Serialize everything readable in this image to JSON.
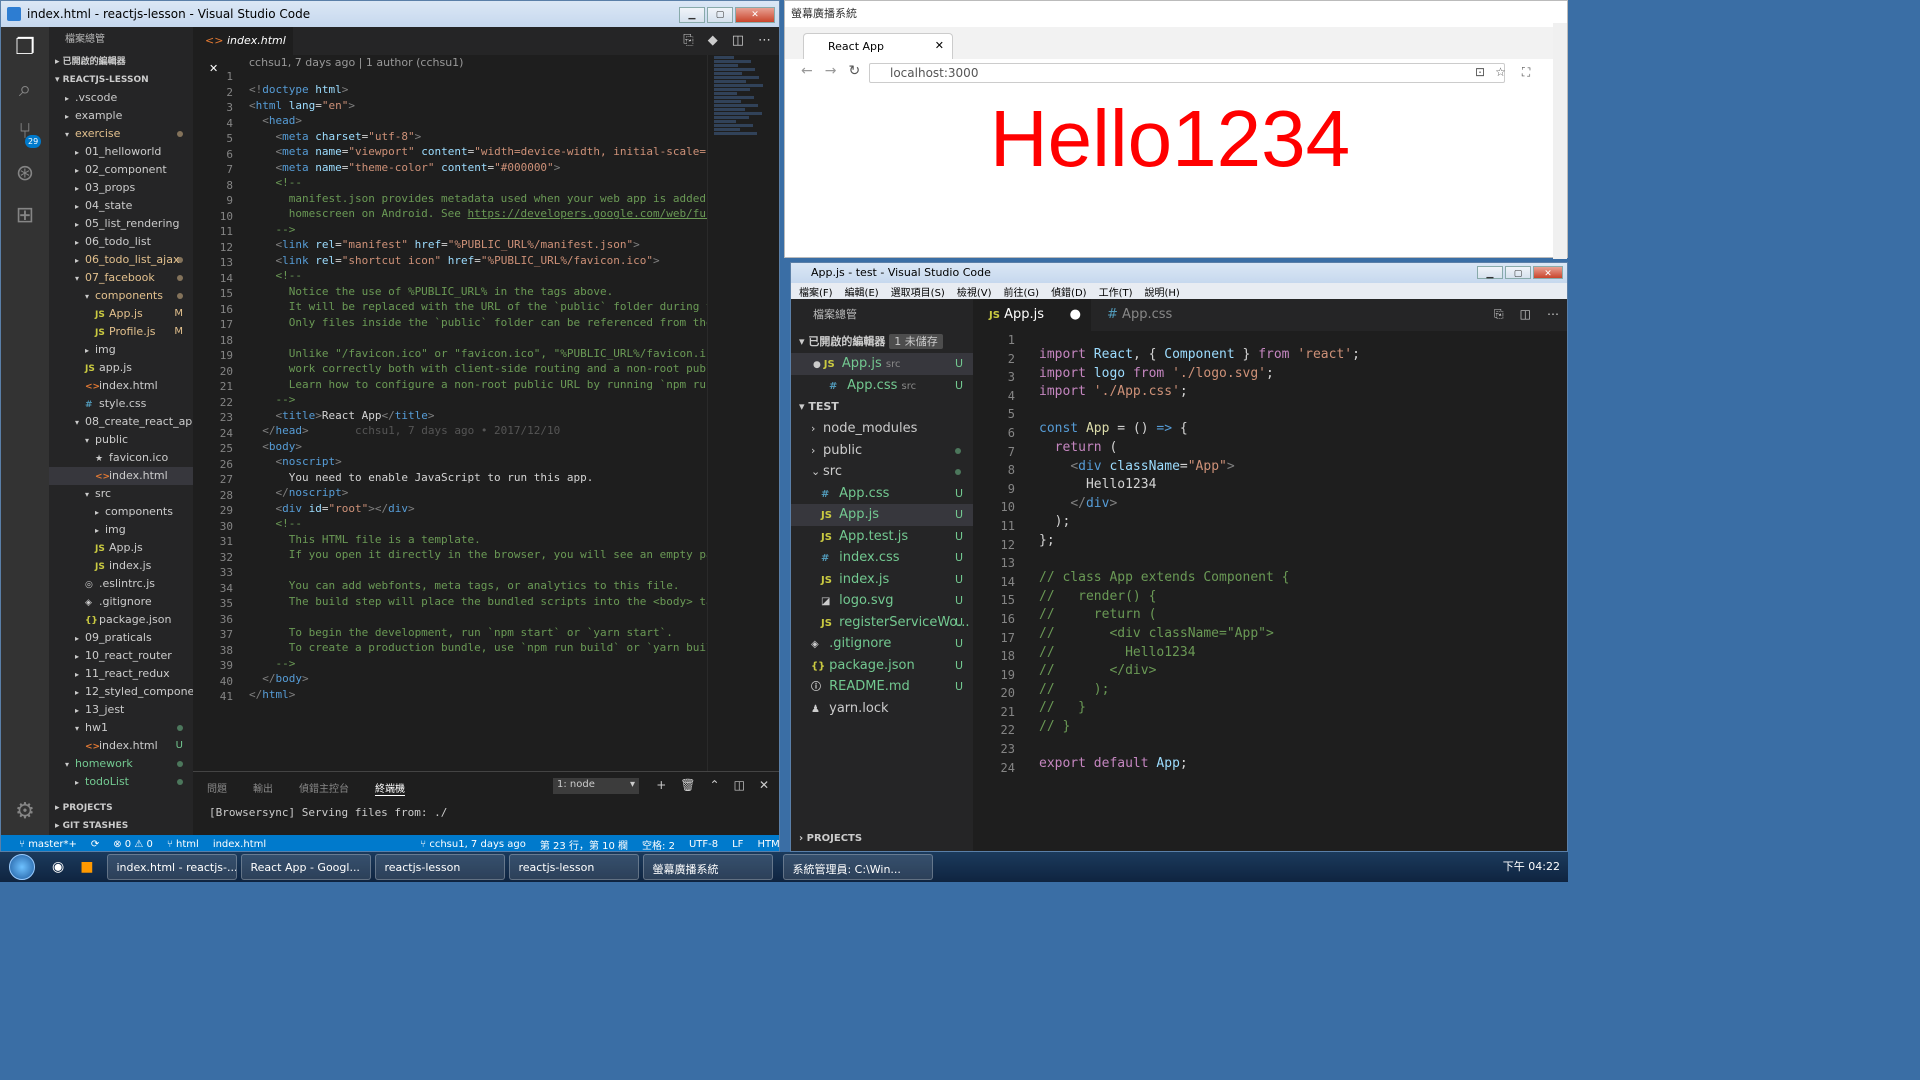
{
  "left_window": {
    "title": "index.html - reactjs-lesson - Visual Studio Code",
    "explorer_header": "檔案總管",
    "open_editors": "已開啟的編輯器",
    "root": "REACTJS-LESSON",
    "tree": [
      {
        "label": ".vscode",
        "indent": 1,
        "arrow": "▸",
        "icon": "",
        "mark": ""
      },
      {
        "label": "example",
        "indent": 1,
        "arrow": "▸",
        "icon": "",
        "mark": ""
      },
      {
        "label": "exercise",
        "indent": 1,
        "arrow": "▾",
        "icon": "",
        "mark": "dot",
        "color": "m"
      },
      {
        "label": "01_helloworld",
        "indent": 2,
        "arrow": "▸",
        "icon": "",
        "mark": ""
      },
      {
        "label": "02_component",
        "indent": 2,
        "arrow": "▸",
        "icon": "",
        "mark": ""
      },
      {
        "label": "03_props",
        "indent": 2,
        "arrow": "▸",
        "icon": "",
        "mark": ""
      },
      {
        "label": "04_state",
        "indent": 2,
        "arrow": "▸",
        "icon": "",
        "mark": ""
      },
      {
        "label": "05_list_rendering",
        "indent": 2,
        "arrow": "▸",
        "icon": "",
        "mark": ""
      },
      {
        "label": "06_todo_list",
        "indent": 2,
        "arrow": "▸",
        "icon": "",
        "mark": ""
      },
      {
        "label": "06_todo_list_ajax",
        "indent": 2,
        "arrow": "▸",
        "icon": "",
        "mark": "dot",
        "color": "m"
      },
      {
        "label": "07_facebook",
        "indent": 2,
        "arrow": "▾",
        "icon": "",
        "mark": "dot",
        "color": "m"
      },
      {
        "label": "components",
        "indent": 3,
        "arrow": "▾",
        "icon": "",
        "mark": "dot",
        "color": "m"
      },
      {
        "label": "App.js",
        "indent": 4,
        "arrow": "",
        "icon": "JS",
        "mark": "M",
        "color": "m"
      },
      {
        "label": "Profile.js",
        "indent": 4,
        "arrow": "",
        "icon": "JS",
        "mark": "M",
        "color": "m"
      },
      {
        "label": "img",
        "indent": 3,
        "arrow": "▸",
        "icon": "",
        "mark": ""
      },
      {
        "label": "app.js",
        "indent": 3,
        "arrow": "",
        "icon": "JS",
        "mark": ""
      },
      {
        "label": "index.html",
        "indent": 3,
        "arrow": "",
        "icon": "<>",
        "mark": ""
      },
      {
        "label": "style.css",
        "indent": 3,
        "arrow": "",
        "icon": "#",
        "mark": ""
      },
      {
        "label": "08_create_react_app",
        "indent": 2,
        "arrow": "▾",
        "icon": "",
        "mark": ""
      },
      {
        "label": "public",
        "indent": 3,
        "arrow": "▾",
        "icon": "",
        "mark": ""
      },
      {
        "label": "favicon.ico",
        "indent": 4,
        "arrow": "",
        "icon": "★",
        "mark": ""
      },
      {
        "label": "index.html",
        "indent": 4,
        "arrow": "",
        "icon": "<>",
        "mark": "",
        "selected": true
      },
      {
        "label": "src",
        "indent": 3,
        "arrow": "▾",
        "icon": "",
        "mark": ""
      },
      {
        "label": "components",
        "indent": 4,
        "arrow": "▸",
        "icon": "",
        "mark": ""
      },
      {
        "label": "img",
        "indent": 4,
        "arrow": "▸",
        "icon": "",
        "mark": ""
      },
      {
        "label": "App.js",
        "indent": 4,
        "arrow": "",
        "icon": "JS",
        "mark": ""
      },
      {
        "label": "index.js",
        "indent": 4,
        "arrow": "",
        "icon": "JS",
        "mark": ""
      },
      {
        "label": ".eslintrc.js",
        "indent": 3,
        "arrow": "",
        "icon": "◎",
        "mark": ""
      },
      {
        "label": ".gitignore",
        "indent": 3,
        "arrow": "",
        "icon": "◈",
        "mark": ""
      },
      {
        "label": "package.json",
        "indent": 3,
        "arrow": "",
        "icon": "{}",
        "mark": ""
      },
      {
        "label": "09_praticals",
        "indent": 2,
        "arrow": "▸",
        "icon": "",
        "mark": ""
      },
      {
        "label": "10_react_router",
        "indent": 2,
        "arrow": "▸",
        "icon": "",
        "mark": ""
      },
      {
        "label": "11_react_redux",
        "indent": 2,
        "arrow": "▸",
        "icon": "",
        "mark": ""
      },
      {
        "label": "12_styled_components",
        "indent": 2,
        "arrow": "▸",
        "icon": "",
        "mark": ""
      },
      {
        "label": "13_jest",
        "indent": 2,
        "arrow": "▸",
        "icon": "",
        "mark": ""
      },
      {
        "label": "hw1",
        "indent": 2,
        "arrow": "▾",
        "icon": "",
        "mark": "dot",
        "color": "u"
      },
      {
        "label": "index.html",
        "indent": 3,
        "arrow": "",
        "icon": "<>",
        "mark": "U",
        "color": "u"
      },
      {
        "label": "homework",
        "indent": 1,
        "arrow": "▾",
        "icon": "",
        "mark": "dot",
        "color": "u",
        "green": true
      },
      {
        "label": "todoList",
        "indent": 2,
        "arrow": "▸",
        "icon": "",
        "mark": "dot",
        "color": "u",
        "green": true
      }
    ],
    "projects": "PROJECTS",
    "git_stashes": "GIT STASHES",
    "tab": "index.html",
    "blame": "cchsu1, 7 days ago | 1 author (cchsu1)",
    "inline_blame": "cchsu1, 7 days ago • 2017/12/10",
    "panel_tabs": [
      "問題",
      "輸出",
      "偵錯主控台",
      "終端機"
    ],
    "terminal_select": "1: node",
    "terminal_line1": "[Browsersync] Serving files from: ./",
    "status": {
      "branch": "master*+",
      "errors": "⊗ 0 ⚠ 0",
      "file_type": "html",
      "file": "index.html",
      "blame": "cchsu1, 7 days ago",
      "cursor": "第 23 行，第 10 欄",
      "spaces": "空格: 2",
      "encoding": "UTF-8",
      "eol": "LF",
      "lang": "HTML"
    },
    "badge_count": "29",
    "settings_badge": "1"
  },
  "browser": {
    "window_title": "螢幕廣播系統",
    "tab_title": "React App",
    "address": "localhost:3000",
    "content": "Hello1234"
  },
  "right_window": {
    "title": "App.js - test - Visual Studio Code",
    "menu": [
      "檔案(F)",
      "編輯(E)",
      "選取項目(S)",
      "檢視(V)",
      "前往(G)",
      "偵錯(D)",
      "工作(T)",
      "說明(H)"
    ],
    "explorer_header": "檔案總管",
    "open_editors": "已開啟的編輯器",
    "unsaved": "1 未儲存",
    "open_files": [
      {
        "label": "App.js",
        "sub": "src",
        "icon": "JS",
        "mark": "U"
      },
      {
        "label": "App.css",
        "sub": "src",
        "icon": "#",
        "mark": "U"
      }
    ],
    "root": "TEST",
    "tree": [
      {
        "label": "node_modules",
        "arrow": "›",
        "icon": "",
        "mark": ""
      },
      {
        "label": "public",
        "arrow": "›",
        "icon": "",
        "mark": "dot"
      },
      {
        "label": "src",
        "arrow": "⌄",
        "icon": "",
        "mark": "dot"
      },
      {
        "label": "App.css",
        "arrow": "",
        "icon": "#",
        "mark": "U",
        "indent": 1
      },
      {
        "label": "App.js",
        "arrow": "",
        "icon": "JS",
        "mark": "U",
        "indent": 1,
        "selected": true
      },
      {
        "label": "App.test.js",
        "arrow": "",
        "icon": "JS",
        "mark": "U",
        "indent": 1
      },
      {
        "label": "index.css",
        "arrow": "",
        "icon": "#",
        "mark": "U",
        "indent": 1
      },
      {
        "label": "index.js",
        "arrow": "",
        "icon": "JS",
        "mark": "U",
        "indent": 1
      },
      {
        "label": "logo.svg",
        "arrow": "",
        "icon": "◪",
        "mark": "U",
        "indent": 1
      },
      {
        "label": "registerServiceWo...",
        "arrow": "",
        "icon": "JS",
        "mark": "U",
        "indent": 1
      },
      {
        "label": ".gitignore",
        "arrow": "",
        "icon": "◈",
        "mark": "U"
      },
      {
        "label": "package.json",
        "arrow": "",
        "icon": "{}",
        "mark": "U"
      },
      {
        "label": "README.md",
        "arrow": "",
        "icon": "ⓘ",
        "mark": "U"
      },
      {
        "label": "yarn.lock",
        "arrow": "",
        "icon": "♟",
        "mark": ""
      }
    ],
    "projects": "PROJECTS",
    "tab_active": "App.js",
    "tab_other": "App.css"
  },
  "taskbar": {
    "items": [
      "index.html - reactjs-...",
      "React App - Googl...",
      "reactjs-lesson",
      "reactjs-lesson",
      "螢幕廣播系統",
      "系統管理員: C:\\Win..."
    ],
    "clock": "下午 04:22"
  }
}
